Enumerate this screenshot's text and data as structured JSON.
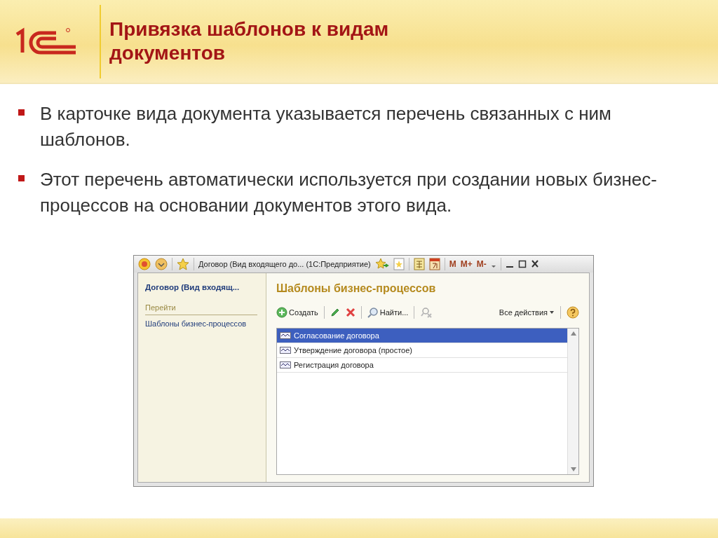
{
  "slide": {
    "title": "Привязка шаблонов к видам документов",
    "bullets": [
      "В карточке вида документа указывается перечень связанных с ним шаблонов.",
      "Этот перечень автоматически используется при создании новых бизнес-процессов на основании документов этого вида."
    ]
  },
  "window": {
    "title": "Договор (Вид входящего до... (1С:Предприятие)",
    "memory_buttons": [
      "M",
      "M+",
      "M-"
    ],
    "sidebar": {
      "title": "Договор (Вид входящ...",
      "section": "Перейти",
      "items": [
        {
          "label": "Шаблоны бизнес-процессов"
        }
      ]
    },
    "content": {
      "title": "Шаблоны бизнес-процессов",
      "create": "Создать",
      "find": "Найти...",
      "all_actions": "Все действия",
      "rows": [
        {
          "label": "Согласование договора",
          "selected": true
        },
        {
          "label": "Утверждение договора (простое)",
          "selected": false
        },
        {
          "label": "Регистрация договора",
          "selected": false
        }
      ]
    }
  }
}
